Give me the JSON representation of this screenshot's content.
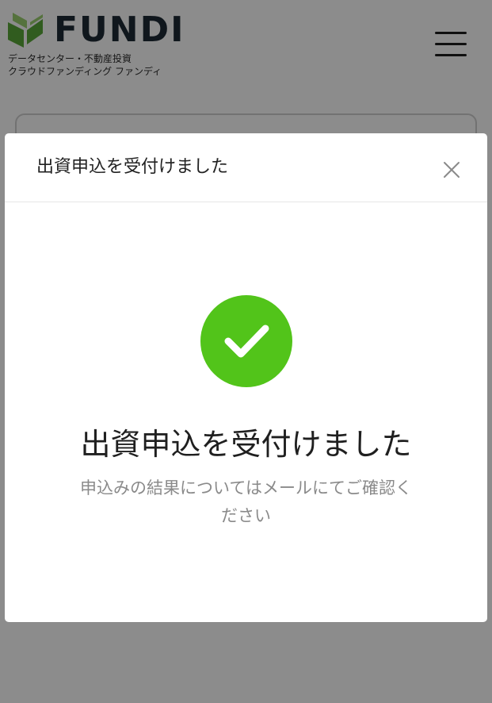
{
  "header": {
    "brand_name": "FUNDI",
    "tagline_line1": "データセンター・不動産投資",
    "tagline_line2": "クラウドファンディング ファンディ",
    "menu_icon": "hamburger-menu-icon"
  },
  "modal": {
    "title": "出資申込を受付けました",
    "close_icon": "close-icon",
    "success_icon": "check-circle-icon",
    "heading": "出資申込を受付けました",
    "message": "申込みの結果についてはメールにてご確認ください"
  },
  "colors": {
    "brand_dark": "#1e2a35",
    "brand_green": "#5aa83a",
    "brand_green_light": "#9bcf6f",
    "success_green": "#52c41a",
    "overlay": "rgba(0,0,0,0.45)"
  }
}
